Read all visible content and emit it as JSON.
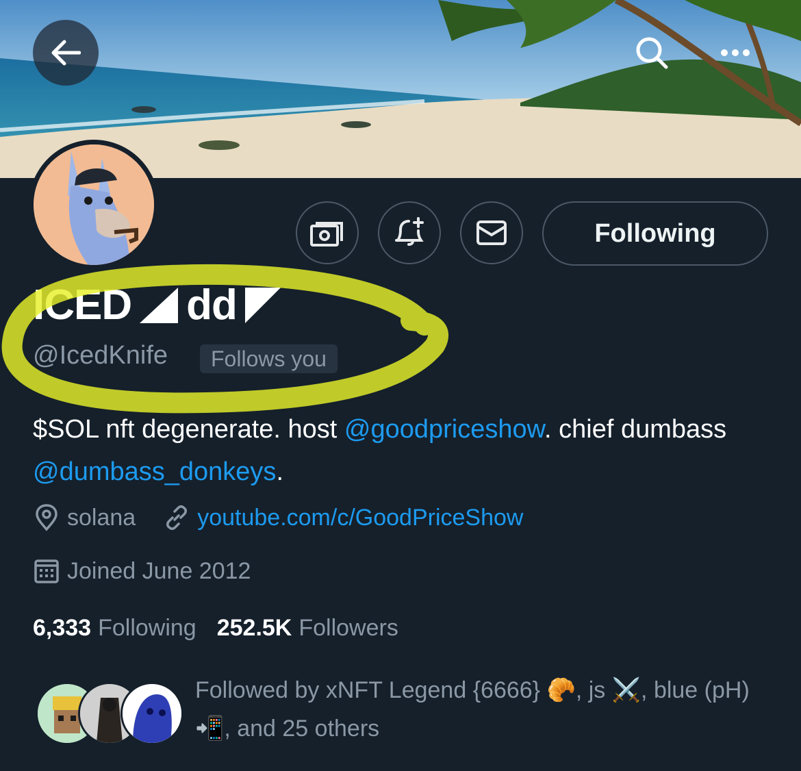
{
  "header": {
    "back_icon": "arrow-left-icon",
    "search_icon": "search-icon",
    "more_icon": "more-horizontal-icon"
  },
  "profile": {
    "display_name_part1": "ICED",
    "display_name_part2": "dd",
    "handle": "@IcedKnife",
    "follows_you": "Follows you",
    "bio": {
      "part1": "$SOL nft degenerate. host ",
      "mention1": "@goodpriceshow",
      "part2": ". chief dumbass ",
      "mention2": "@dumbass_donkeys",
      "part3": "."
    },
    "location": "solana",
    "website": "youtube.com/c/GoodPriceShow",
    "joined": "Joined June 2012",
    "following_count": "6,333",
    "following_label": "Following",
    "followers_count": "252.5K",
    "followers_label": "Followers",
    "followed_by": "Followed by xNFT Legend {6666} 🥐, js ⚔️, blue (pH) 📲, and 25 others"
  },
  "actions": {
    "tip_icon": "money-icon",
    "notify_icon": "bell-plus-icon",
    "message_icon": "envelope-icon",
    "following_button": "Following"
  },
  "colors": {
    "background": "#15202b",
    "accent": "#1d9bf0",
    "secondary_text": "#8b98a5",
    "highlight_marker": "#e6f02a"
  }
}
